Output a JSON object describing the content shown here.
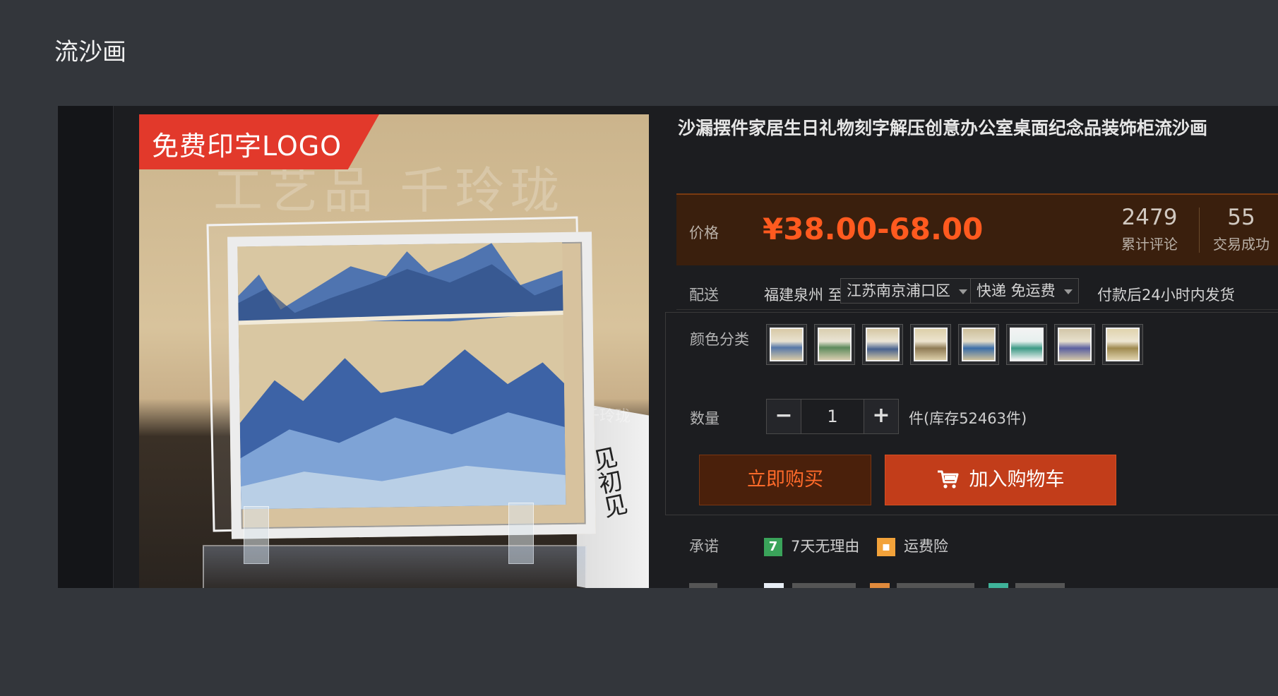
{
  "page_title": "流沙画",
  "image": {
    "promo_label": "免费印字LOGO",
    "watermark": "工艺品 千玲珑",
    "watermark_small": "千玲珑",
    "book_text": "见初见"
  },
  "product": {
    "title": "沙漏摆件家居生日礼物刻字解压创意办公室桌面纪念品装饰柜流沙画",
    "price_label": "价格",
    "price": "¥38.00-68.00",
    "stats": [
      {
        "value": "2479",
        "label": "累计评论"
      },
      {
        "value": "55",
        "label": "交易成功"
      }
    ]
  },
  "shipping": {
    "label": "配送",
    "from": "福建泉州 至",
    "destination": "江苏南京浦口区",
    "method": "快递 免运费",
    "note": "付款后24小时内发货"
  },
  "options": {
    "color_label": "颜色分类",
    "swatch_count": 8,
    "quantity_label": "数量",
    "quantity": "1",
    "minus": "−",
    "plus": "+",
    "stock": "件(库存52463件)"
  },
  "actions": {
    "buy_now": "立即购买",
    "add_to_cart": "加入购物车"
  },
  "promise": {
    "label": "承诺",
    "items": [
      {
        "icon": "seven-day-return-icon",
        "icon_text": "7",
        "text": "7天无理由"
      },
      {
        "icon": "shipping-insurance-icon",
        "icon_text": "",
        "text": "运费险"
      }
    ]
  },
  "colors": {
    "background": "#33363b",
    "panel": "#1c1d20",
    "price": "#ff5a1f",
    "buy_button": "#4a200b",
    "cart_button": "#c23d1a",
    "promo": "#e2392b"
  }
}
